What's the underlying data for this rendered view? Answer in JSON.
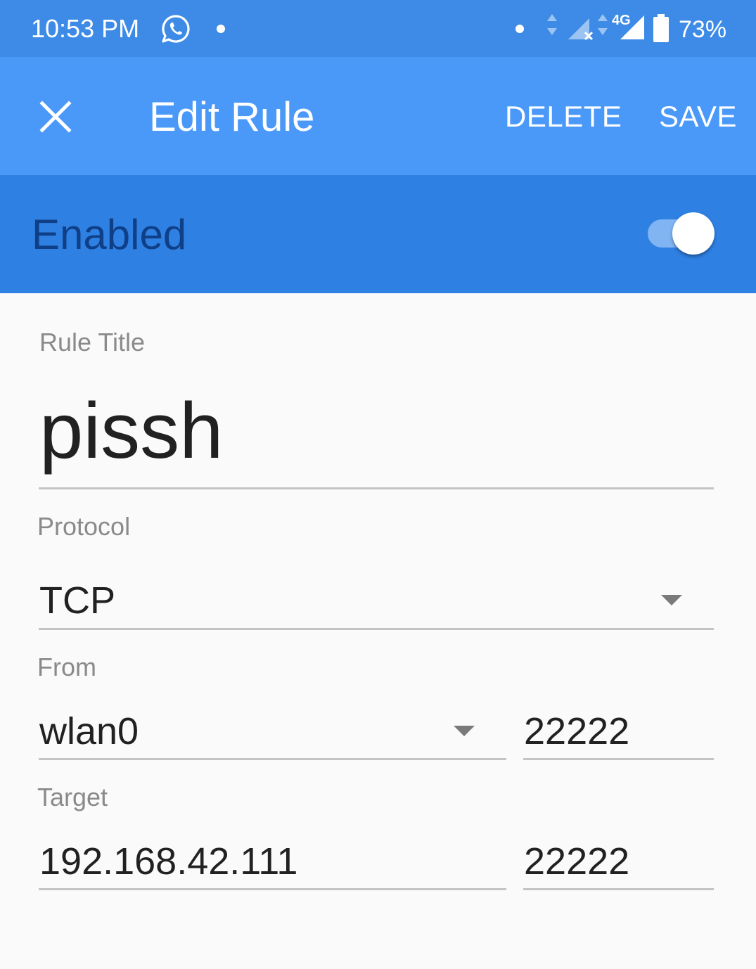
{
  "status_bar": {
    "time": "10:53 PM",
    "network_label": "4G",
    "battery": "73%",
    "icons": [
      "whatsapp-icon",
      "notification-dot-icon",
      "data-arrows-icon",
      "signal-icon",
      "battery-icon"
    ]
  },
  "toolbar": {
    "close_icon": "close-icon",
    "title": "Edit Rule",
    "delete_label": "DELETE",
    "save_label": "SAVE"
  },
  "enabled": {
    "label": "Enabled",
    "value": true
  },
  "form": {
    "rule_title": {
      "label": "Rule Title",
      "value": "pissh"
    },
    "protocol": {
      "label": "Protocol",
      "value": "TCP"
    },
    "from": {
      "label": "From",
      "interface": "wlan0",
      "port": "22222"
    },
    "target": {
      "label": "Target",
      "address": "192.168.42.111",
      "port": "22222"
    }
  },
  "colors": {
    "status_bar": "#3d8be6",
    "toolbar": "#4a99f9",
    "enabled_bar": "#2f80e3",
    "enabled_text": "#0f3f87",
    "background": "#fafafa"
  }
}
